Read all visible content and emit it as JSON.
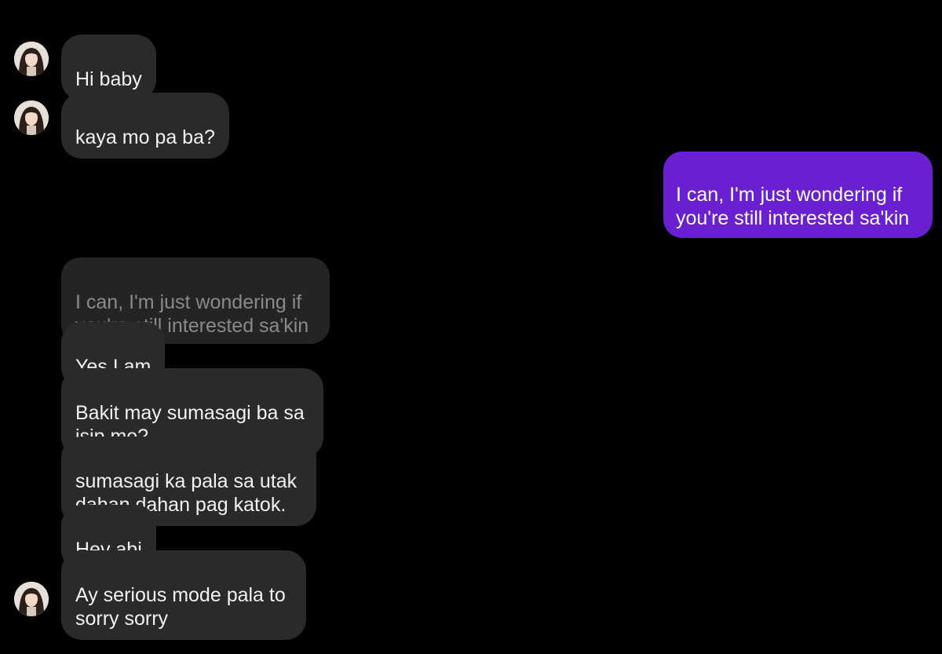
{
  "conversation": {
    "messages": [
      {
        "sender": "them",
        "text": "Hi baby"
      },
      {
        "sender": "them",
        "text": "kaya mo pa ba?"
      },
      {
        "sender": "me",
        "text": "I can, I'm just wondering if\nyou're still interested sa'kin"
      },
      {
        "sender": "them",
        "reply_to": "I can, I'm just wondering if\nyou're still interested sa'kin",
        "text": "Yes I am"
      },
      {
        "sender": "them",
        "text": "Bakit may sumasagi ba sa\nisip mo?"
      },
      {
        "sender": "them",
        "text": "sumasagi ka pala sa utak\ndahan dahan pag katok."
      },
      {
        "sender": "them",
        "text": "Hev abi"
      },
      {
        "sender": "them",
        "text": "Ay serious mode pala to\nsorry sorry"
      }
    ]
  },
  "icons": {
    "avatar": "contact-avatar-icon"
  },
  "colors": {
    "background": "#000000",
    "incoming_bubble": "#2a2a2a",
    "outgoing_bubble": "#6a1fd0",
    "quoted_text": "#8a8a8a",
    "message_text": "#f2f2f2"
  }
}
